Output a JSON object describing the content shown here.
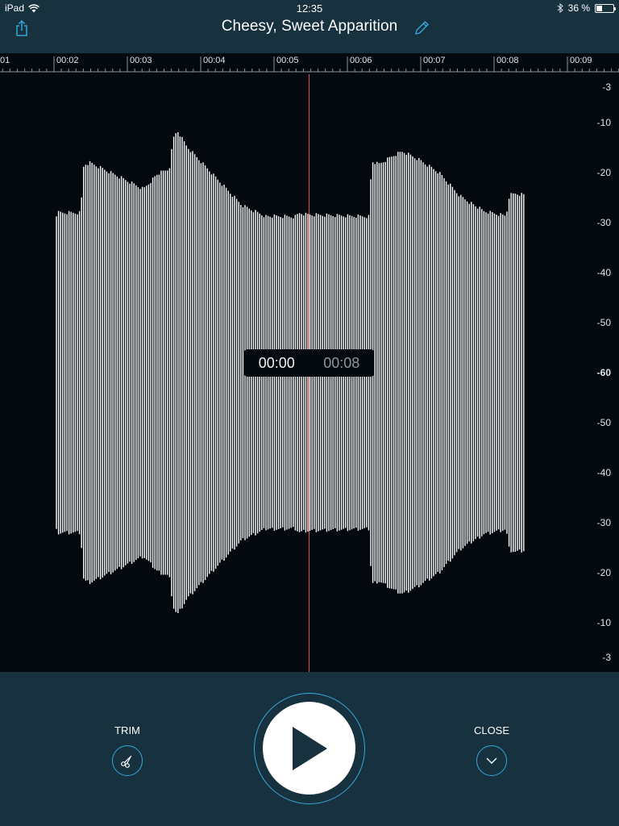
{
  "status_bar": {
    "device": "iPad",
    "time": "12:35",
    "battery_percent": "36 %",
    "battery_level": 0.36
  },
  "header": {
    "title": "Cheesy, Sweet Apparition",
    "share_icon": "share-icon",
    "edit_icon": "pencil-icon"
  },
  "timeline": {
    "labels": [
      "01",
      "00:02",
      "00:03",
      "00:04",
      "00:05",
      "00:06",
      "00:07",
      "00:08",
      "00:09"
    ]
  },
  "db_scale": {
    "labels": [
      "-3",
      "-10",
      "-20",
      "-30",
      "-40",
      "-50",
      "-60",
      "-50",
      "-40",
      "-30",
      "-20",
      "-10",
      "-3"
    ]
  },
  "playback": {
    "elapsed": "00:00",
    "total": "00:08"
  },
  "controls": {
    "trim_label": "TRIM",
    "close_label": "CLOSE",
    "trim_icon": "scissors-icon",
    "close_icon": "chevron-down-icon",
    "play_icon": "play-icon"
  },
  "colors": {
    "panel": "#17313f",
    "background": "#03090f",
    "accent": "#34a8d8",
    "playhead": "#e0525a",
    "waveform": "#ffffff"
  }
}
